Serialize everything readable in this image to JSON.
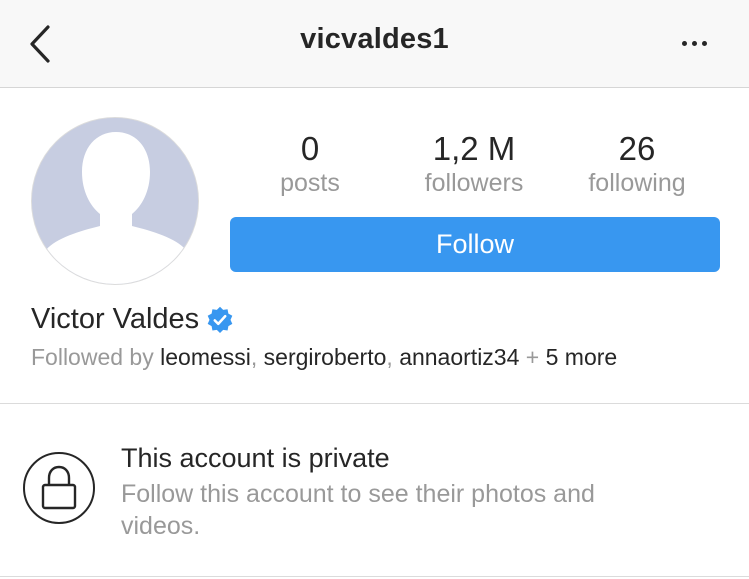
{
  "header": {
    "title": "vicvaldes1",
    "back_icon": "chevron-left-icon",
    "more_icon": "more-horizontal-icon"
  },
  "profile": {
    "avatar_icon": "default-avatar-silhouette",
    "name": "Victor Valdes",
    "verified_icon": "verified-badge-icon",
    "stats": [
      {
        "value": "0",
        "label": "posts"
      },
      {
        "value": "1,2 M",
        "label": "followers"
      },
      {
        "value": "26",
        "label": "following"
      }
    ],
    "follow_label": "Follow",
    "followed_by": {
      "prefix": "Followed by",
      "users": [
        "leomessi",
        "sergiroberto",
        "annaortiz34"
      ],
      "plus": "+",
      "more": "5 more"
    }
  },
  "private_notice": {
    "icon": "lock-icon",
    "title": "This account is private",
    "description": "Follow this account to see their photos and videos."
  },
  "colors": {
    "accent": "#3897f0",
    "verified": "#3897f0",
    "text": "#262626",
    "secondary_text": "#999999",
    "header_bg": "#f8f8f8"
  }
}
